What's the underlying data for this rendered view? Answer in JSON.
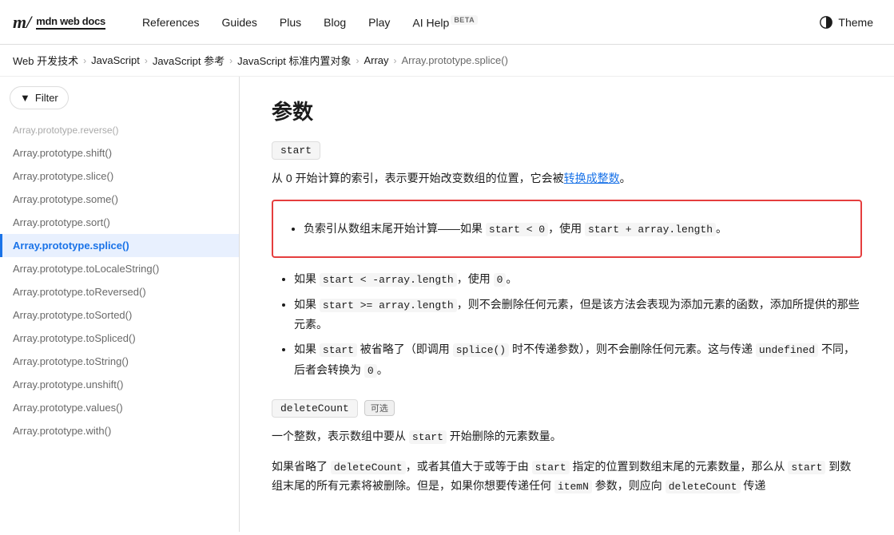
{
  "nav": {
    "logo_m": "m/",
    "logo_text": "mdn web docs",
    "links": [
      {
        "id": "references",
        "label": "References"
      },
      {
        "id": "guides",
        "label": "Guides"
      },
      {
        "id": "plus",
        "label": "Plus"
      },
      {
        "id": "blog",
        "label": "Blog"
      },
      {
        "id": "play",
        "label": "Play"
      },
      {
        "id": "ai-help",
        "label": "AI Help",
        "badge": "BETA"
      }
    ],
    "theme_label": "Theme"
  },
  "breadcrumb": {
    "items": [
      {
        "label": "Web 开发技术"
      },
      {
        "label": "JavaScript"
      },
      {
        "label": "JavaScript 参考"
      },
      {
        "label": "JavaScript 标准内置对象"
      },
      {
        "label": "Array"
      },
      {
        "label": "Array.prototype.splice()"
      }
    ]
  },
  "sidebar": {
    "filter_label": "Filter",
    "items": [
      {
        "label": "Array.prototype.reverse()",
        "faded": true
      },
      {
        "label": "Array.prototype.shift()"
      },
      {
        "label": "Array.prototype.slice()"
      },
      {
        "label": "Array.prototype.some()"
      },
      {
        "label": "Array.prototype.sort()"
      },
      {
        "label": "Array.prototype.splice()",
        "active": true
      },
      {
        "label": "Array.prototype.toLocaleString()"
      },
      {
        "label": "Array.prototype.toReversed()"
      },
      {
        "label": "Array.prototype.toSorted()"
      },
      {
        "label": "Array.prototype.toSpliced()"
      },
      {
        "label": "Array.prototype.toString()"
      },
      {
        "label": "Array.prototype.unshift()"
      },
      {
        "label": "Array.prototype.values()"
      },
      {
        "label": "Array.prototype.with()"
      }
    ]
  },
  "content": {
    "section_title": "参数",
    "params": [
      {
        "id": "start",
        "name": "start",
        "description_before_link": "从 0 开始计算的索引，表示要开始改变数组的位置，它会被",
        "link_text": "转换成整数",
        "description_after_link": "。",
        "highlighted": true,
        "highlighted_text": "负索引从数组末尾开始计算——如果 start < 0，使用 start + array.length。",
        "bullets": [
          "如果 start < -array.length，使用 0。",
          "如果 start >= array.length，则不会删除任何元素，但是该方法会表现为添加元素的函数，添加所提供的那些元素。",
          "如果 start 被省略了（即调用 splice() 时不传递参数），则不会删除任何元素。这与传递 undefined 不同，后者会转换为 0。"
        ]
      },
      {
        "id": "deleteCount",
        "name": "deleteCount",
        "optional_label": "可选",
        "description": "一个整数，表示数组中要从 start 开始删除的元素数量。",
        "description2_before": "如果省略了 deleteCount，或者其值大于或等于由 start 指定的位置到数组末尾的元素数量，那么从 start 到数组末尾的所有元素将被删除。但是，如果你想要传递任何 itemN 参数，则应向 deleteCount 传递",
        "description2_after": "到数组末尾的所有元素将被删除。但是，如果你想要传递任何 itemN 参数，则应向 deleteCount 传递"
      }
    ]
  },
  "colors": {
    "accent": "#1a73e8",
    "active_bg": "#e8f0fe",
    "active_border": "#1a73e8",
    "highlight_border": "#e53e3e",
    "link": "#1a73e8"
  }
}
